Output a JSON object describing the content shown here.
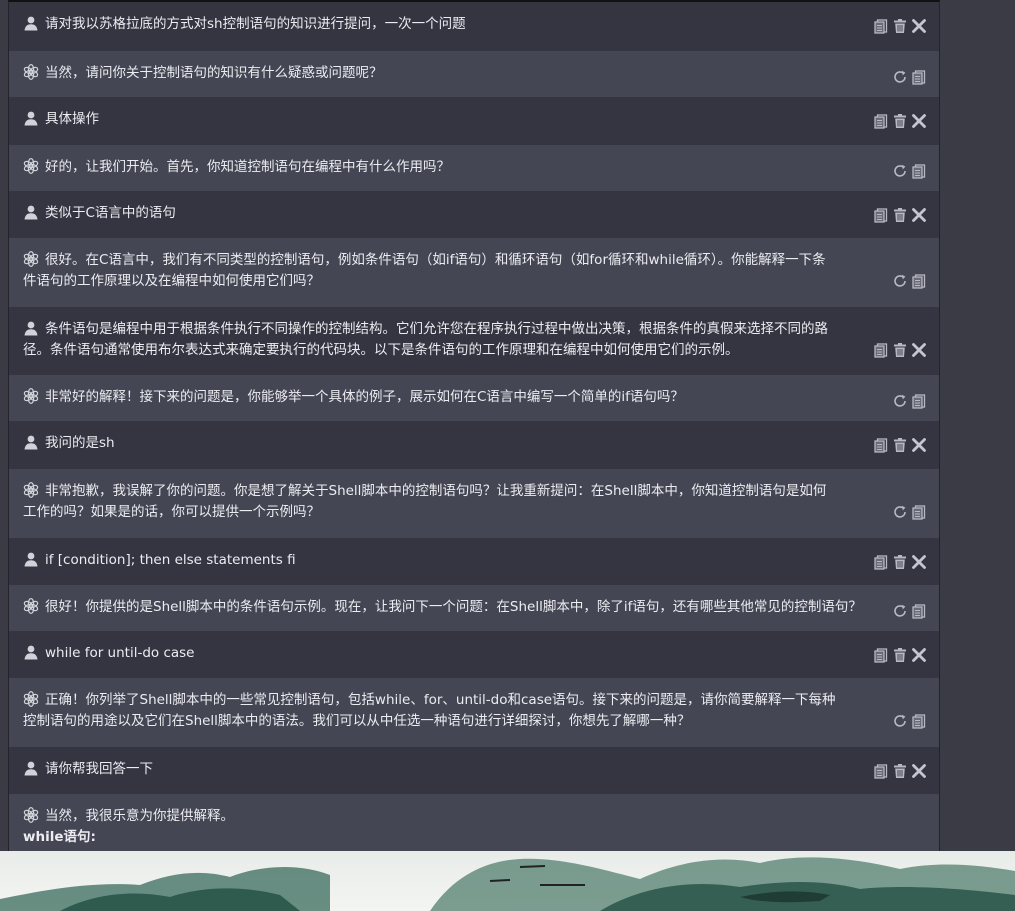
{
  "messages": [
    {
      "role": "user",
      "text": "请对我以苏格拉底的方式对sh控制语句的知识进行提问，一次一个问题"
    },
    {
      "role": "assistant",
      "text": "当然，请问你关于控制语句的知识有什么疑惑或问题呢？"
    },
    {
      "role": "user",
      "text": "具体操作"
    },
    {
      "role": "assistant",
      "text": "好的，让我们开始。首先，你知道控制语句在编程中有什么作用吗？"
    },
    {
      "role": "user",
      "text": "类似于C语言中的语句"
    },
    {
      "role": "assistant",
      "text": "很好。在C语言中，我们有不同类型的控制语句，例如条件语句（如if语句）和循环语句（如for循环和while循环）。你能解释一下条件语句的工作原理以及在编程中如何使用它们吗？"
    },
    {
      "role": "user",
      "text": "条件语句是编程中用于根据条件执行不同操作的控制结构。它们允许您在程序执行过程中做出决策，根据条件的真假来选择不同的路径。条件语句通常使用布尔表达式来确定要执行的代码块。以下是条件语句的工作原理和在编程中如何使用它们的示例。"
    },
    {
      "role": "assistant",
      "text": "非常好的解释！接下来的问题是，你能够举一个具体的例子，展示如何在C语言中编写一个简单的if语句吗？"
    },
    {
      "role": "user",
      "text": "我问的是sh"
    },
    {
      "role": "assistant",
      "text": "非常抱歉，我误解了你的问题。你是想了解关于Shell脚本中的控制语句吗？让我重新提问：在Shell脚本中，你知道控制语句是如何工作的吗？如果是的话，你可以提供一个示例吗？"
    },
    {
      "role": "user",
      "text": "if [condition]; then else statements fi"
    },
    {
      "role": "assistant",
      "text": "很好！你提供的是Shell脚本中的条件语句示例。现在，让我问下一个问题：在Shell脚本中，除了if语句，还有哪些其他常见的控制语句？"
    },
    {
      "role": "user",
      "text": "while for until-do case"
    },
    {
      "role": "assistant",
      "text": "正确！你列举了Shell脚本中的一些常见控制语句，包括while、for、until-do和case语句。接下来的问题是，请你简要解释一下每种控制语句的用途以及它们在Shell脚本中的语法。我们可以从中任选一种语句进行详细探讨，你想先了解哪一种？"
    },
    {
      "role": "user",
      "text": "请你帮我回答一下"
    },
    {
      "role": "assistant",
      "text": "当然，我很乐意为你提供解释。",
      "bold_text": "while语句:"
    }
  ],
  "icons": {
    "user_avatar": "user-avatar-icon",
    "assistant_avatar": "openai-logo-icon",
    "copy": "copy-icon",
    "delete": "trash-icon",
    "close": "close-icon",
    "regenerate": "refresh-icon"
  },
  "colors": {
    "user_bg": "#343541",
    "assistant_bg": "#444654",
    "page_bg": "#3a3b45",
    "text": "#ececf1",
    "icon": "#c5c5d2"
  }
}
